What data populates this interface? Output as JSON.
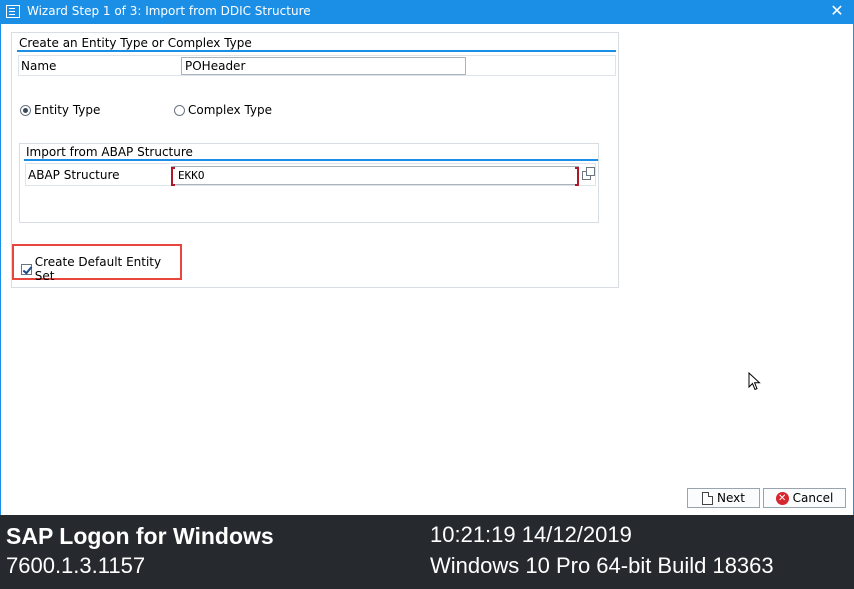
{
  "window": {
    "title": "Wizard Step 1 of 3: Import from DDIC Structure",
    "close_glyph": "✕"
  },
  "entity_group": {
    "title": "Create an Entity Type or Complex Type",
    "name_label": "Name",
    "name_value": "POHeader",
    "radio_entity_type": {
      "label": "Entity Type",
      "selected": true
    },
    "radio_complex_type": {
      "label": "Complex Type",
      "selected": false
    }
  },
  "abap_group": {
    "title": "Import from ABAP Structure",
    "structure_label": "ABAP Structure",
    "structure_value": "EKKO"
  },
  "default_entity_set": {
    "label": "Create Default Entity Set",
    "checked": true
  },
  "buttons": {
    "next_label": "Next",
    "cancel_label": "Cancel"
  },
  "footer": {
    "app_name": "SAP Logon for Windows",
    "version": "7600.1.3.1157",
    "datetime": "10:21:19 14/12/2019",
    "os": "Windows 10 Pro 64-bit Build 18363"
  },
  "colors": {
    "titlebar": "#1b8fe6",
    "highlight_border": "#e8453c",
    "footer_bg": "#262a2f"
  },
  "icons": [
    "window-app-icon",
    "close-icon",
    "value-help-icon",
    "next-doc-icon",
    "cancel-icon",
    "mouse-pointer-icon"
  ]
}
